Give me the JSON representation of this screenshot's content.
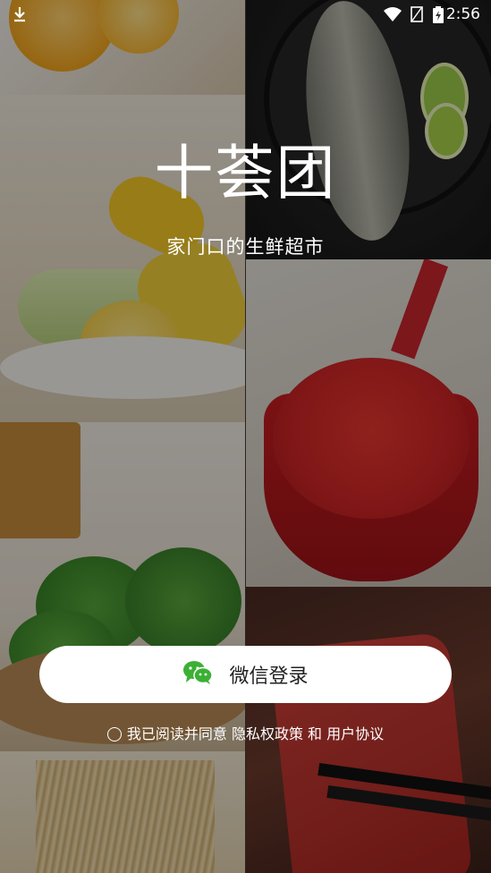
{
  "status_bar": {
    "time": "2:56",
    "icons": [
      "download-icon",
      "wifi-icon",
      "no-sim-icon",
      "battery-charging-icon"
    ]
  },
  "brand": {
    "logo_text": "十荟团",
    "tagline": "家门口的生鲜超市"
  },
  "login": {
    "button_label": "微信登录",
    "icon": "wechat-icon",
    "icon_color": "#3cb034"
  },
  "agreement": {
    "prefix": "我已阅读并同意",
    "privacy_link": "隐私权政策",
    "conjunction": "和",
    "user_agreement_link": "用户协议"
  },
  "background_tiles": [
    "oranges",
    "fish",
    "corn",
    "strawberries",
    "broccoli",
    "wheat",
    "tuna"
  ]
}
